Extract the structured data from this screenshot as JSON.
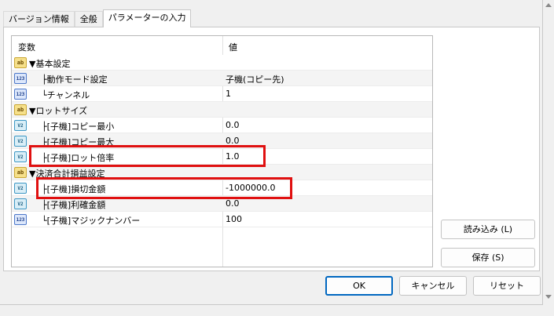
{
  "tabs": [
    "バージョン情報",
    "全般",
    "パラメーターの入力"
  ],
  "grid": {
    "col_variable": "変数",
    "col_value": "値",
    "rows": [
      {
        "icon": "ab",
        "name": "▼基本設定",
        "value": ""
      },
      {
        "icon": "123",
        "name": "├動作モード設定",
        "value": "子機(コピー先)"
      },
      {
        "icon": "123",
        "name": "└チャンネル",
        "value": "1"
      },
      {
        "icon": "ab",
        "name": "▼ロットサイズ",
        "value": ""
      },
      {
        "icon": "V2",
        "name": "├[子機]コピー最小",
        "value": "0.0"
      },
      {
        "icon": "V2",
        "name": "├[子機]コピー最大",
        "value": "0.0"
      },
      {
        "icon": "V2",
        "name": "├[子機]ロット倍率",
        "value": "1.0"
      },
      {
        "icon": "ab",
        "name": "▼決済合計損益設定",
        "value": ""
      },
      {
        "icon": "V2",
        "name": "├[子機]損切金額",
        "value": "-1000000.0"
      },
      {
        "icon": "V2",
        "name": "├[子機]利確金額",
        "value": "0.0"
      },
      {
        "icon": "123",
        "name": "└[子機]マジックナンバー",
        "value": "100"
      }
    ]
  },
  "buttons": {
    "load": "読み込み (L)",
    "save": "保存 (S)",
    "ok": "OK",
    "cancel": "キャンセル",
    "reset": "リセット"
  },
  "colors": {
    "highlight": "#e01010",
    "primary_border": "#0067c0"
  }
}
